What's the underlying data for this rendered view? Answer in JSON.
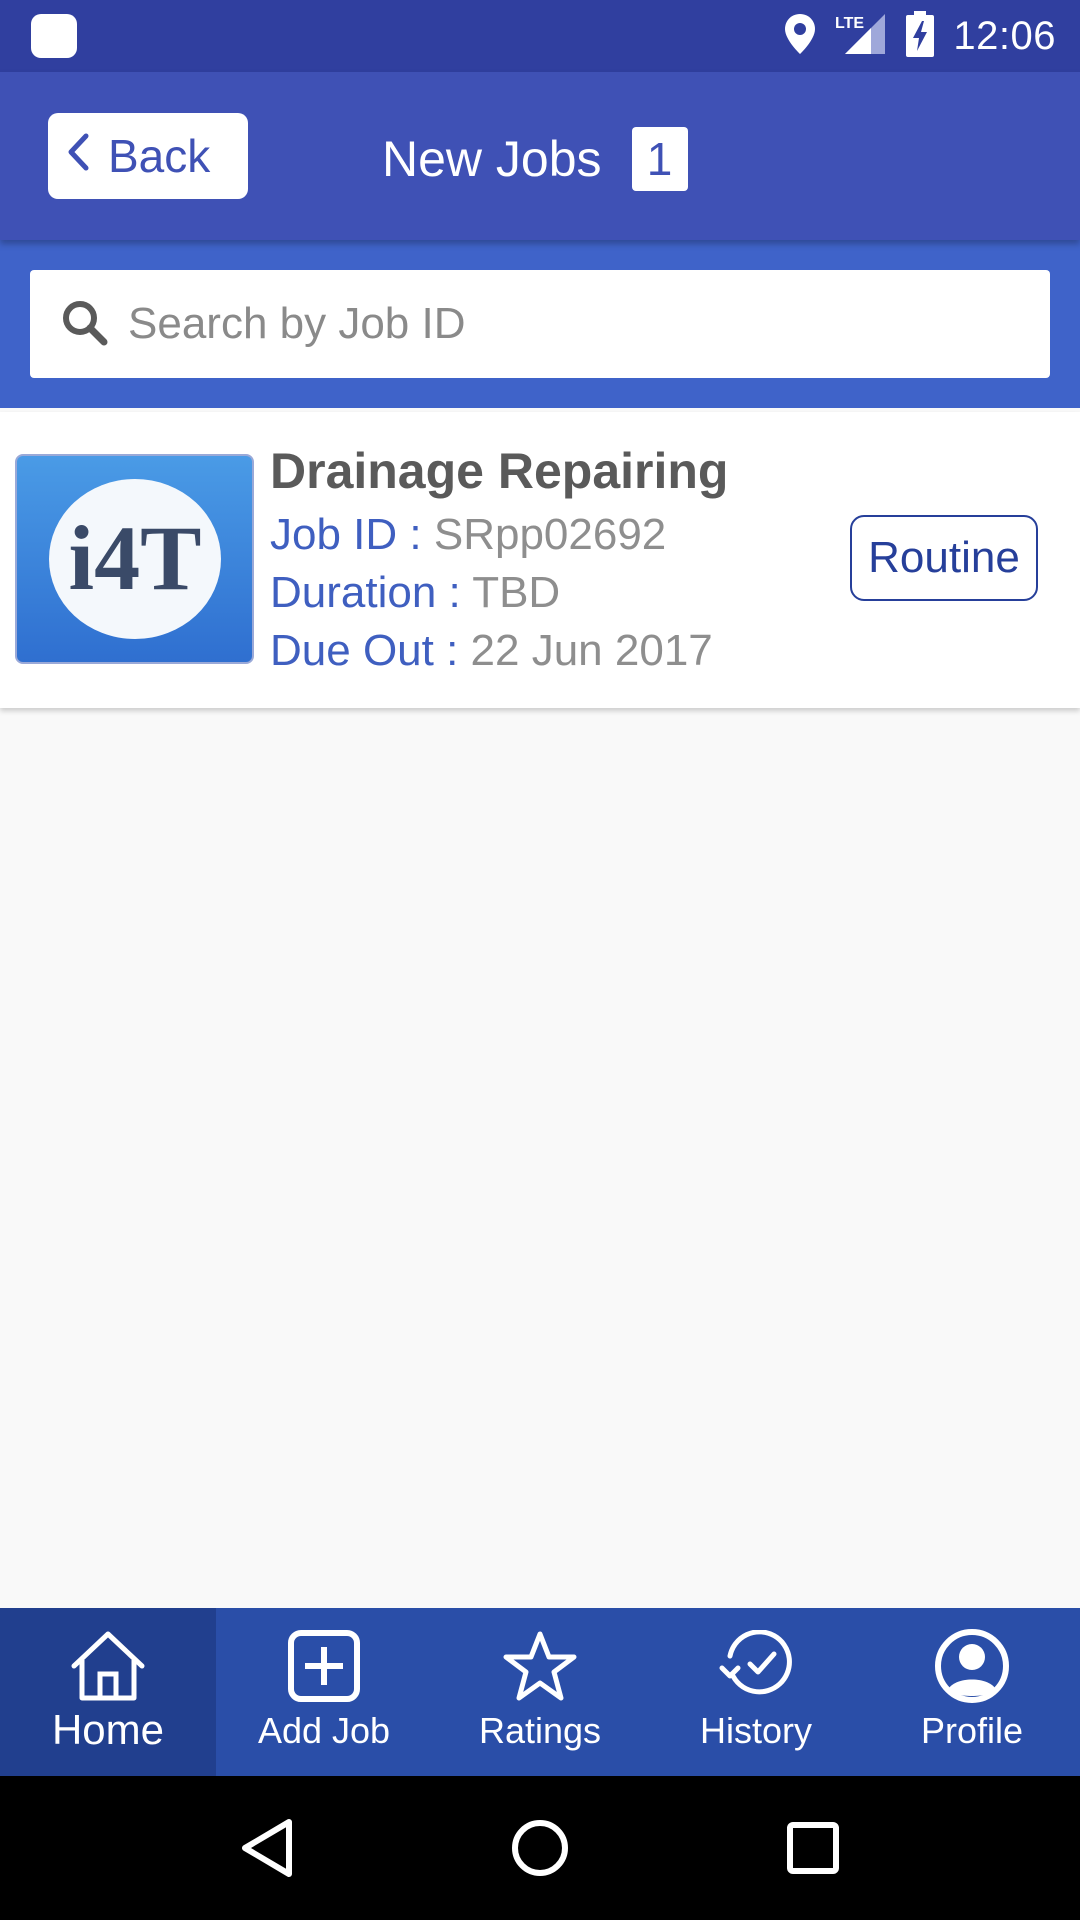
{
  "status_bar": {
    "time": "12:06",
    "icons": [
      "location-icon",
      "lte-signal-icon",
      "battery-charging-icon"
    ]
  },
  "header": {
    "back_label": "Back",
    "title": "New Jobs",
    "count": "1"
  },
  "search": {
    "placeholder": "Search by Job ID",
    "value": ""
  },
  "jobs": [
    {
      "title": "Drainage Repairing",
      "job_id_label": "Job ID : ",
      "job_id": "SRpp02692",
      "duration_label": "Duration : ",
      "duration": "TBD",
      "due_out_label": "Due Out : ",
      "due_out": "22 Jun 2017",
      "tag": "Routine",
      "thumbnail_text": "i4T"
    }
  ],
  "bottom_nav": {
    "items": [
      {
        "label": "Home",
        "icon": "home-icon",
        "active": true
      },
      {
        "label": "Add Job",
        "icon": "add-box-icon",
        "active": false
      },
      {
        "label": "Ratings",
        "icon": "star-icon",
        "active": false
      },
      {
        "label": "History",
        "icon": "history-icon",
        "active": false
      },
      {
        "label": "Profile",
        "icon": "profile-icon",
        "active": false
      }
    ]
  },
  "colors": {
    "status_bar": "#303f9f",
    "header": "#3f51b5",
    "search_area": "#3f63c9",
    "bottom_nav": "#2a4ea8",
    "bottom_nav_active": "#213f8e",
    "label_blue": "#3f5fc0"
  }
}
